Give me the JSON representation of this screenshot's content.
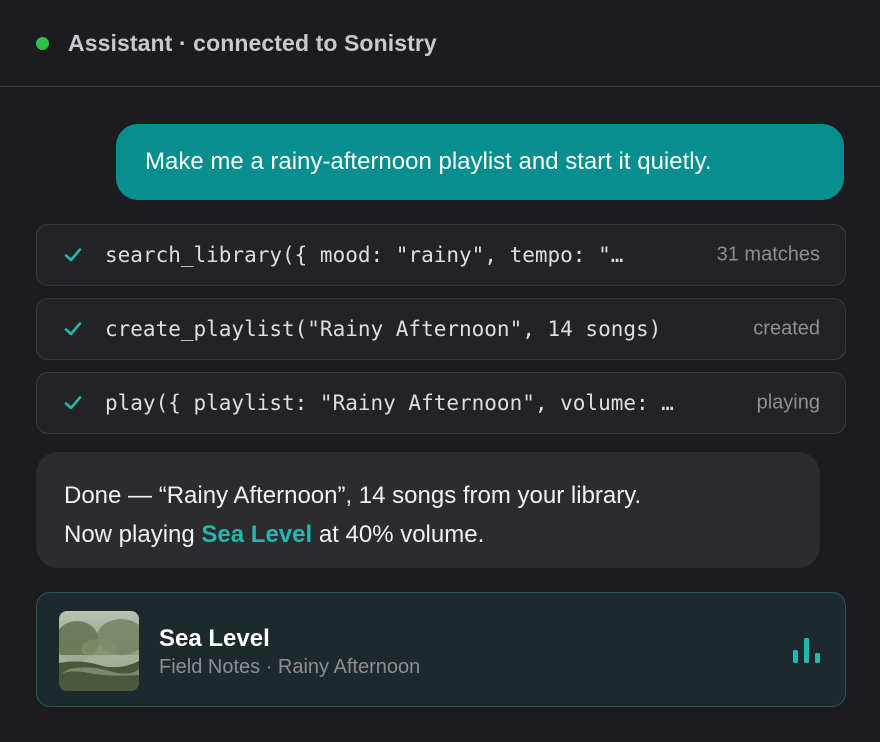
{
  "header": {
    "title": "Assistant · connected to Sonistry",
    "status_color": "#30c04a"
  },
  "messages": {
    "user": "Make me a rainy-afternoon playlist and start it quietly.",
    "assistant": {
      "line1": "Done — “Rainy Afternoon”, 14 songs from your library.",
      "line2_prefix": "Now playing ",
      "line2_track": "Sea Level",
      "line2_suffix": " at 40% volume."
    }
  },
  "tool_calls": [
    {
      "code": "search_library({ mood: \"rainy\", tempo: \"…",
      "status": "31 matches",
      "icon": "check-icon"
    },
    {
      "code": "create_playlist(\"Rainy Afternoon\", 14 songs)",
      "status": "created",
      "icon": "check-icon"
    },
    {
      "code": "play({ playlist: \"Rainy Afternoon\", volume: …",
      "status": "playing",
      "icon": "check-icon"
    }
  ],
  "now_playing": {
    "title": "Sea Level",
    "meta": "Field Notes · Rainy Afternoon",
    "icon": "equalizer-icon",
    "accent_color": "#25b7ad"
  }
}
